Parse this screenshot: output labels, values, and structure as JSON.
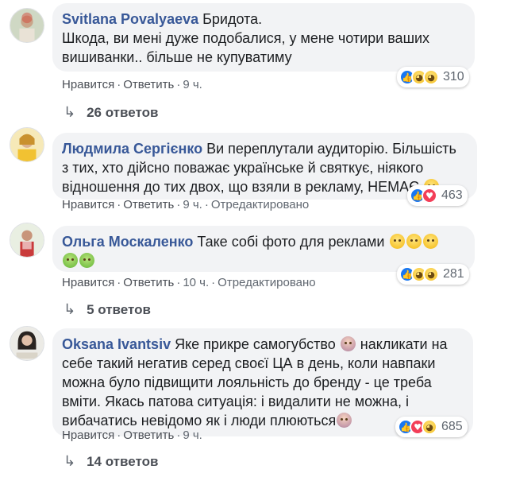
{
  "comments": [
    {
      "author": "Svitlana Povalyaeva",
      "text_line1": "Бридота.",
      "text_line2": "Шкода, ви мені дуже подобалися, у мене чотири ваших",
      "text_line3": "вишиванки.. більше не купуватиму",
      "reaction_count": "310",
      "like_label": "Нравится",
      "reply_label": "Ответить",
      "time": "9 ч.",
      "replies_label": "26 ответов"
    },
    {
      "author": "Людмила Сергієнко",
      "text_line1": "Ви переплутали аудиторію. Більшість",
      "text_line2": "з тих, хто дійсно поважає українське й святкує, ніякого",
      "text_line3": "відношення до тих двох, що взяли в рекламу, НЕМАЄ",
      "reaction_count": "463",
      "like_label": "Нравится",
      "reply_label": "Ответить",
      "time": "9 ч.",
      "edited_label": "Отредактировано"
    },
    {
      "author": "Ольга Москаленко",
      "text_line1": "Таке собі фото для реклами",
      "reaction_count": "281",
      "like_label": "Нравится",
      "reply_label": "Ответить",
      "time": "10 ч.",
      "edited_label": "Отредактировано",
      "replies_label": "5 ответов"
    },
    {
      "author": "Oksana Ivantsiv",
      "text_line1": "Яке прикре самогубство",
      "text_line1b": "накликати на",
      "text_line2": "себе такий негатив серед своєї ЦА в день, коли навпаки",
      "text_line3": "можна було підвищити лояльність до бренду - це треба",
      "text_line4": "вміти. Якась патова ситуація: і видалити не можна, і",
      "text_line5": "вибачатись невідомо як і люди плюються",
      "reaction_count": "685",
      "like_label": "Нравится",
      "reply_label": "Ответить",
      "time": "9 ч.",
      "replies_label": "14 ответов"
    }
  ],
  "separator": "·",
  "reply_arrow": "↳",
  "colors": {
    "author": "#385898",
    "bubble": "#f2f3f5",
    "like": "#1877f2",
    "love": "#f33e58"
  }
}
